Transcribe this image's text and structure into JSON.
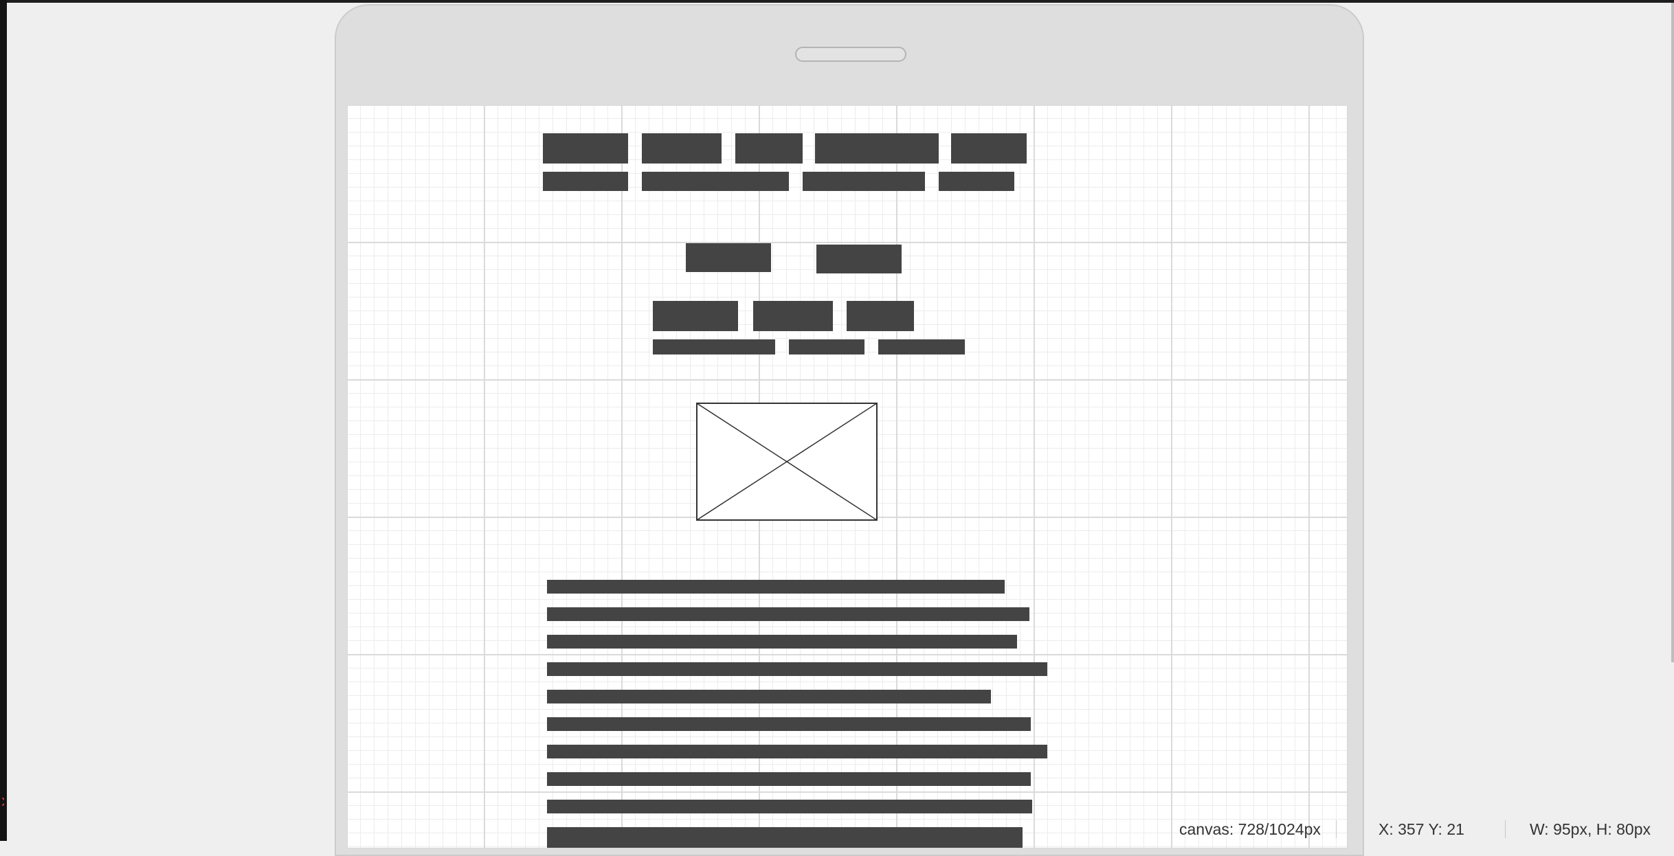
{
  "status_bar": {
    "canvas": "canvas: 728/1024px",
    "coords": "X: 357 Y: 21",
    "size": "W: 95px, H: 80px"
  },
  "wireframe": {
    "image_placeholder": "crossed-box-image-placeholder",
    "text_line_count": 10
  },
  "colors": {
    "block": "#444444",
    "grid_minor": "#ececec",
    "grid_major": "#dadada",
    "device_frame": "#dedede",
    "background": "#efefef"
  }
}
